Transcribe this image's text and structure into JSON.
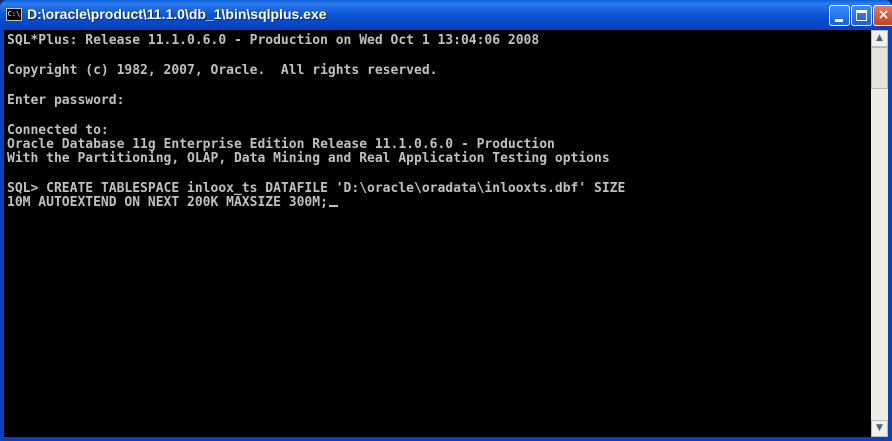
{
  "window": {
    "title": "D:\\oracle\\product\\11.1.0\\db_1\\bin\\sqlplus.exe",
    "app_icon_text": "C:\\",
    "minimize_glyph": "_",
    "maximize_glyph": "□",
    "close_glyph": "×"
  },
  "console": {
    "lines": [
      "SQL*Plus: Release 11.1.0.6.0 - Production on Wed Oct 1 13:04:06 2008",
      "Copyright (c) 1982, 2007, Oracle.  All rights reserved.",
      "Enter password:",
      "Connected to:",
      "Oracle Database 11g Enterprise Edition Release 11.1.0.6.0 - Production",
      "With the Partitioning, OLAP, Data Mining and Real Application Testing options",
      "SQL> CREATE TABLESPACE inloox_ts DATAFILE 'D:\\oracle\\oradata\\inlooxts.dbf' SIZE",
      "10M AUTOEXTEND ON NEXT 200K MAXSIZE 300M;"
    ]
  },
  "scrollbar": {
    "up_arrow": "▲",
    "down_arrow": "▼"
  },
  "colors": {
    "console_background": "#000000",
    "console_text": "#c0c0c0",
    "titlebar": "#0548c6"
  }
}
